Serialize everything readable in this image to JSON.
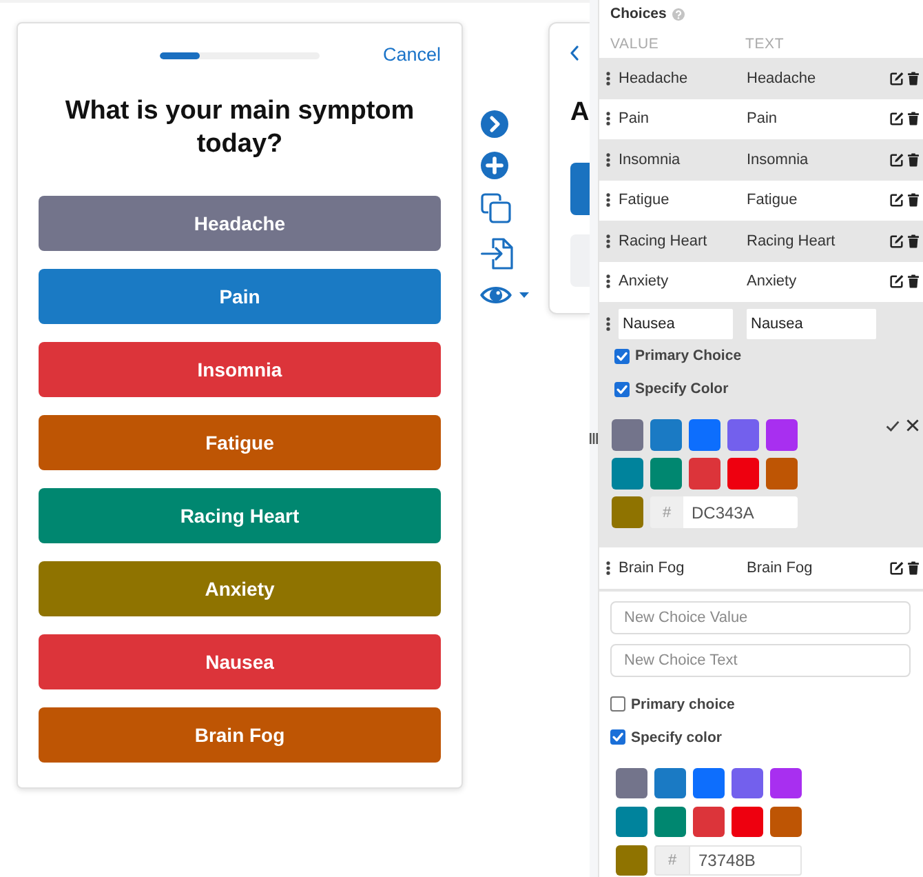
{
  "preview": {
    "progress": {
      "level": 0.25
    },
    "cancel": "Cancel",
    "question": "What is your main symptom today?",
    "options": [
      {
        "label": "Headache",
        "color": "#73748b"
      },
      {
        "label": "Pain",
        "color": "#1a7ac4"
      },
      {
        "label": "Insomnia",
        "color": "#dc343a"
      },
      {
        "label": "Fatigue",
        "color": "#be5504"
      },
      {
        "label": "Racing Heart",
        "color": "#008770"
      },
      {
        "label": "Anxiety",
        "color": "#8f7300"
      },
      {
        "label": "Nausea",
        "color": "#dc343a"
      },
      {
        "label": "Brain Fog",
        "color": "#be5504"
      }
    ]
  },
  "next_card": {
    "question": "A",
    "options": [
      {
        "color": "#1a72c0"
      },
      {
        "color": "#f0f1f3"
      }
    ]
  },
  "choices": {
    "title": "Choices",
    "columns": [
      "VALUE",
      "TEXT"
    ],
    "rows": [
      {
        "kind": "item",
        "value": "Headache",
        "text": "Headache"
      },
      {
        "kind": "item",
        "value": "Pain",
        "text": "Pain"
      },
      {
        "kind": "item",
        "value": "Insomnia",
        "text": "Insomnia"
      },
      {
        "kind": "item",
        "value": "Fatigue",
        "text": "Fatigue"
      },
      {
        "kind": "item",
        "value": "Racing Heart",
        "text": "Racing Heart"
      },
      {
        "kind": "item",
        "value": "Anxiety",
        "text": "Anxiety"
      },
      {
        "kind": "editing",
        "value": "Nausea",
        "text": "Nausea",
        "primary_label": "Primary Choice",
        "primary": true,
        "color_label": "Specify Color",
        "specify_color": true,
        "swatches": [
          {
            "color": "#73748b"
          },
          {
            "color": "#1a7ac4"
          },
          {
            "color": "#0d6efd"
          },
          {
            "color": "#7360ed"
          },
          {
            "color": "#a82ff0"
          },
          {
            "color": "#00839c"
          },
          {
            "color": "#008770"
          },
          {
            "color": "#dc343a"
          },
          {
            "color": "#ee000f"
          },
          {
            "color": "#be5504"
          },
          {
            "color": "#8f7300"
          }
        ],
        "hash": "#",
        "hex": "DC343A"
      },
      {
        "kind": "item",
        "value": "Brain Fog",
        "text": "Brain Fog"
      }
    ]
  },
  "new_choice": {
    "value_placeholder": "New Choice Value",
    "text_placeholder": "New Choice Text",
    "primary_label": "Primary choice",
    "primary": false,
    "color_label": "Specify color",
    "specify_color": true,
    "swatches": [
      {
        "color": "#73748b"
      },
      {
        "color": "#1a7ac4"
      },
      {
        "color": "#0d6efd"
      },
      {
        "color": "#7360ed"
      },
      {
        "color": "#a82ff0"
      },
      {
        "color": "#00839c"
      },
      {
        "color": "#008770"
      },
      {
        "color": "#dc343a"
      },
      {
        "color": "#ee000f"
      },
      {
        "color": "#be5504"
      },
      {
        "color": "#8f7300"
      }
    ],
    "hash": "#",
    "hex": "73748B"
  }
}
